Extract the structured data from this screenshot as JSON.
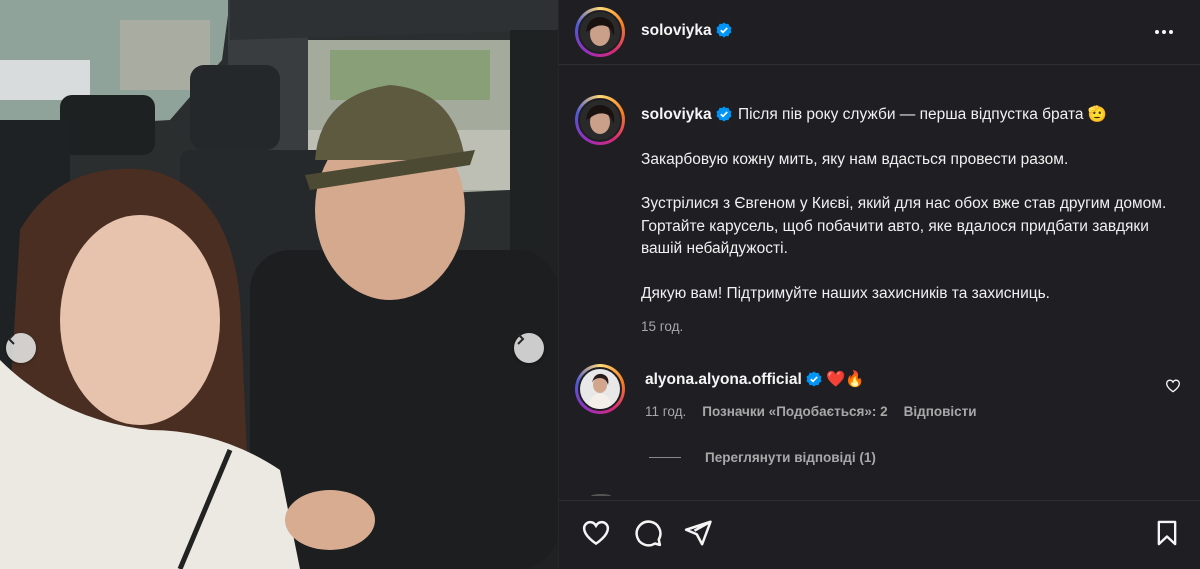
{
  "post": {
    "username": "soloviyka",
    "verified": true,
    "more_icon": "more-horizontal-icon"
  },
  "caption": {
    "username": "soloviyka",
    "line1": "Після пів року служби — перша відпустка брата 🫡",
    "line2": "Закарбовую кожну мить, яку нам вдасться провести разом.",
    "line3": "Зустрілися з Євгеном у Києві, який для нас обох вже став другим домом. Гортайте карусель, щоб побачити авто, яке вдалося придбати завдяки вашій небайдужості.",
    "line4": "Дякую вам! Підтримуйте наших захисників та захисниць.",
    "time": "15 год."
  },
  "comment": {
    "username": "alyona.alyona.official",
    "verified": true,
    "text": "❤️🔥",
    "time": "11 год.",
    "likes": "Позначки «Подобається»: 2",
    "reply": "Відповісти",
    "view_replies": "Переглянути відповіді (1)"
  },
  "colors": {
    "panel_bg": "#1f1f23",
    "text": "#f5f5f5",
    "muted": "#a8a8a8",
    "verified": "#0095f6"
  },
  "icons": [
    "like-heart-icon",
    "comment-icon",
    "share-icon",
    "save-bookmark-icon",
    "carousel-prev-icon",
    "carousel-next-icon"
  ]
}
